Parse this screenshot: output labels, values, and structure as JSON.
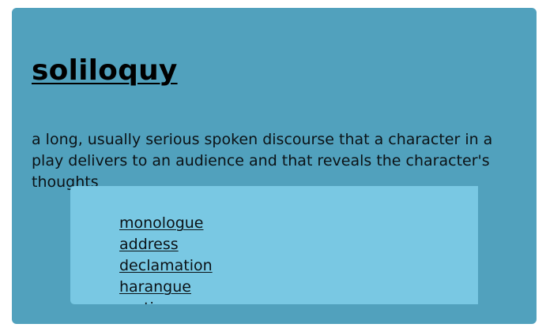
{
  "entry": {
    "word": "soliloquy",
    "definition": "a long, usually serious spoken discourse that a character in a play delivers to an audience and that reveals the character's thoughts"
  },
  "synonyms": [
    {
      "label": "monologue"
    },
    {
      "label": "address"
    },
    {
      "label": "declamation"
    },
    {
      "label": "harangue"
    },
    {
      "label": "oration"
    }
  ],
  "scrollbar": {
    "up_icon": "chevron-up-icon",
    "down_icon": "chevron-down-icon"
  },
  "colors": {
    "card_background": "#51a1bd",
    "list_background": "#79c8e3",
    "scrollbar_track": "#f0f0f0",
    "scrollbar_thumb": "#cdcdcd"
  }
}
